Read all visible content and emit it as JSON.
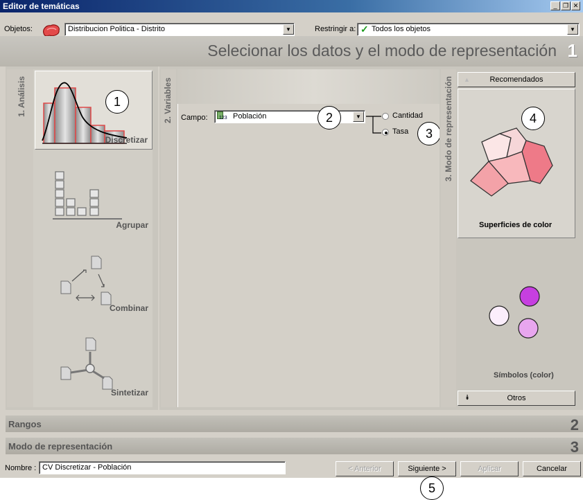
{
  "window": {
    "title": "Editor de temáticas"
  },
  "toolbar": {
    "objects_label": "Objetos:",
    "objects_value": "Distribucion Politica - Distrito",
    "restrict_label": "Restringir a:",
    "restrict_value": "Todos los objetos"
  },
  "header": {
    "title": "Selecionar los datos y el modo de representación",
    "step": "1"
  },
  "analysis": {
    "tab_label": "1. Análisis",
    "items": [
      {
        "label": "Discretizar",
        "selected": true
      },
      {
        "label": "Agrupar",
        "selected": false
      },
      {
        "label": "Combinar",
        "selected": false
      },
      {
        "label": "Sintetizar",
        "selected": false
      }
    ]
  },
  "variables": {
    "tab_label": "2. Variables",
    "field_label": "Campo:",
    "field_value": "Población",
    "field_type_badge": "123",
    "options": [
      {
        "label": "Cantidad",
        "selected": false
      },
      {
        "label": "Tasa",
        "selected": true
      }
    ]
  },
  "representation": {
    "tab_label": "3. Modo de representación",
    "recommended_label": "Recomendados",
    "modes": [
      {
        "label": "Superficies de color",
        "selected": true
      },
      {
        "label": "Símbolos (color)",
        "selected": false
      }
    ],
    "others_label": "Otros"
  },
  "sections": [
    {
      "label": "Rangos",
      "num": "2"
    },
    {
      "label": "Modo de representación",
      "num": "3"
    }
  ],
  "footer": {
    "name_label": "Nombre :",
    "name_value": "CV Discretizar - Población",
    "prev_label": "< Anterior",
    "next_label": "Siguiente >",
    "apply_label": "Aplicar",
    "cancel_label": "Cancelar"
  },
  "callouts": [
    "1",
    "2",
    "3",
    "4",
    "5"
  ],
  "colors": {
    "title_bar": "#0a246a",
    "face": "#d4d0c8",
    "histogram_red": "#e04848",
    "polygon_red": "#e87080",
    "symbol_purple": "#c040e0"
  }
}
